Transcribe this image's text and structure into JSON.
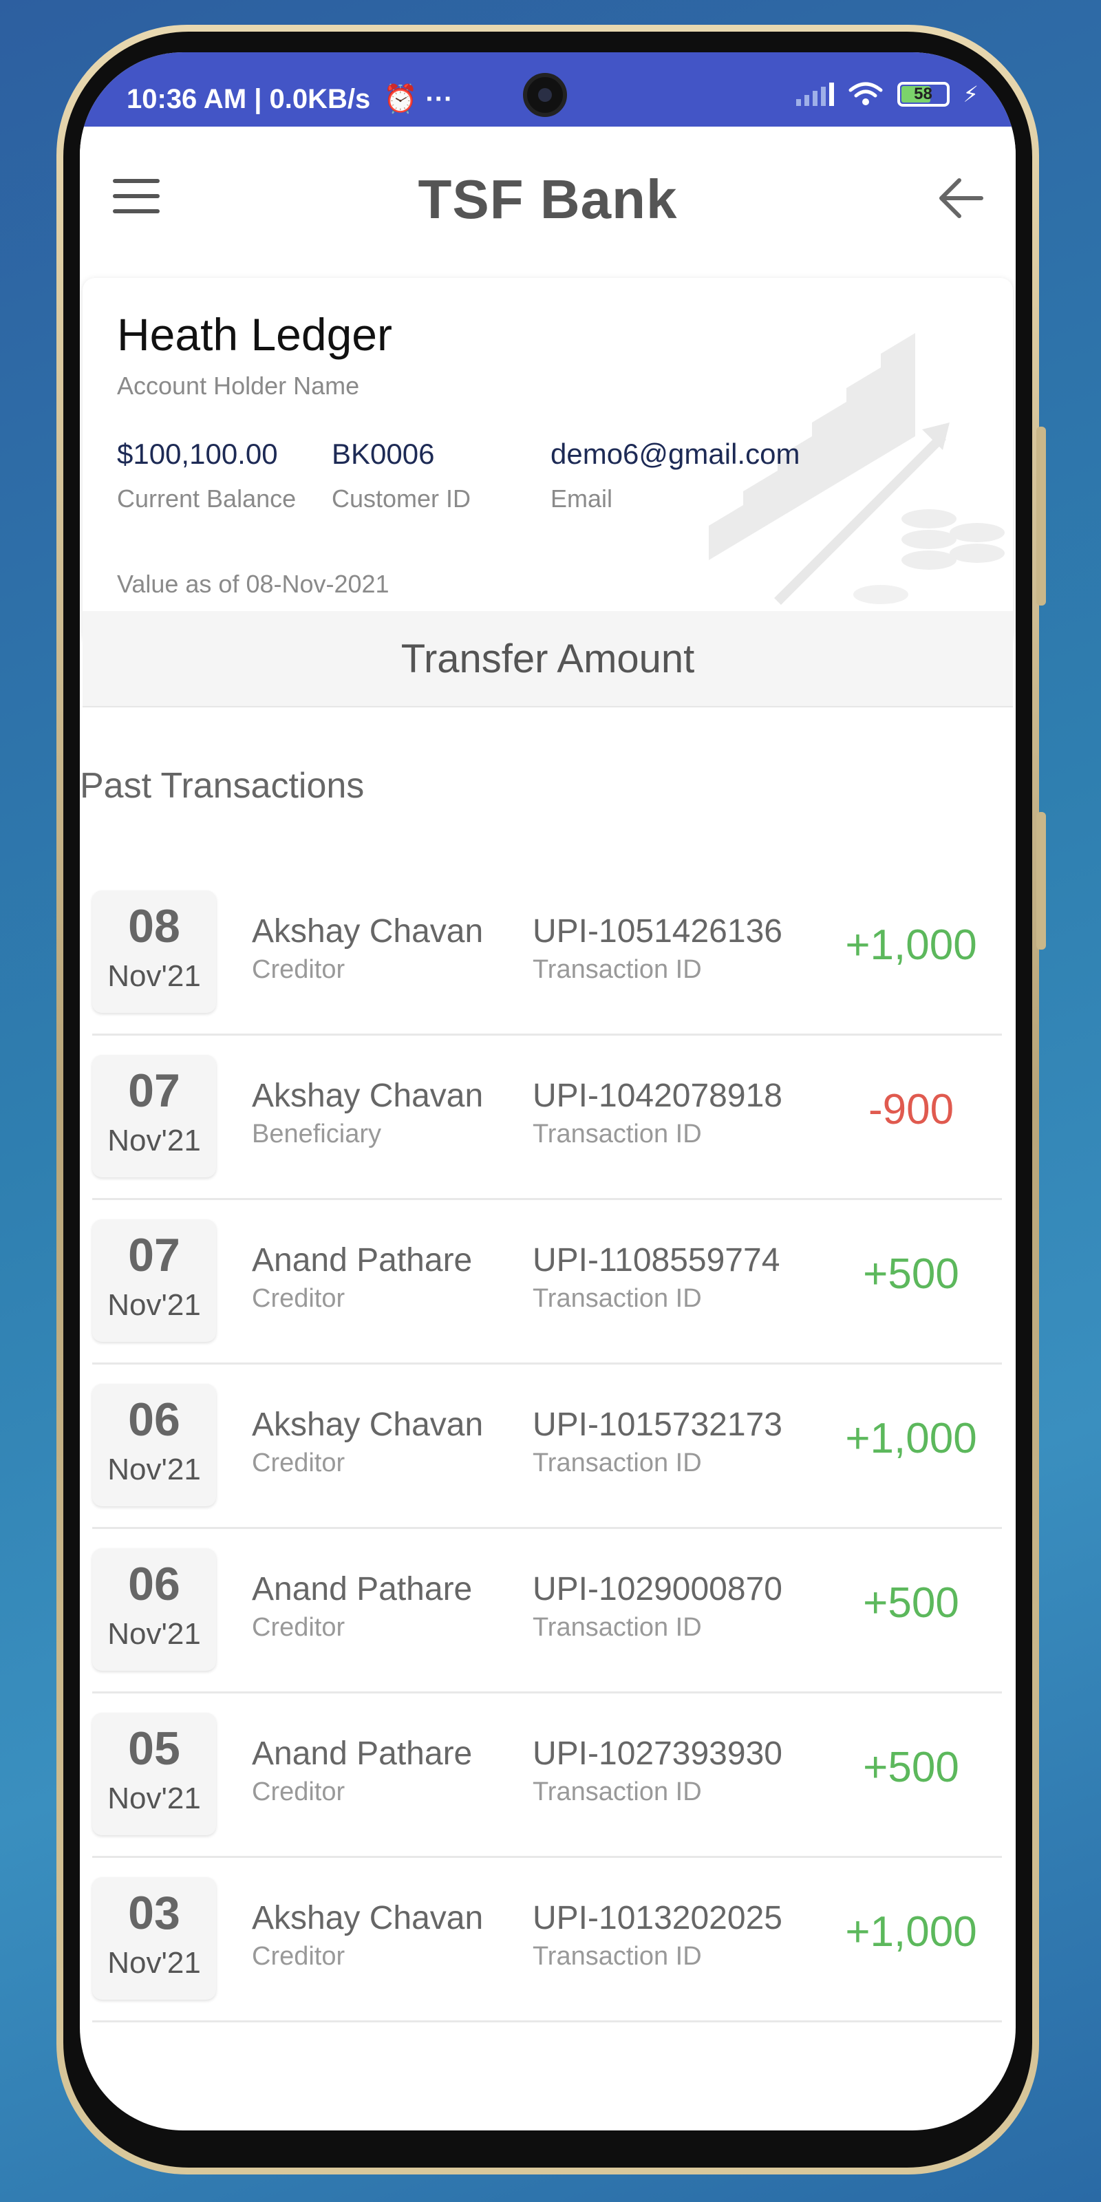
{
  "status_bar": {
    "time": "10:36 AM | 0.0KB/s",
    "extra": "⏰ ···",
    "battery": "58"
  },
  "header": {
    "title": "TSF Bank"
  },
  "account": {
    "holder_name": "Heath Ledger",
    "holder_label": "Account Holder Name",
    "balance": "$100,100.00",
    "balance_label": "Current Balance",
    "customer_id": "BK0006",
    "customer_id_label": "Customer ID",
    "email": "demo6@gmail.com",
    "email_label": "Email",
    "value_as_of": "Value as of 08-Nov-2021"
  },
  "transfer_button": "Transfer Amount",
  "past_transactions_title": "Past Transactions",
  "colors": {
    "credit": "#5cb85c",
    "debit": "#e05a4f",
    "status_bar": "#4355c6"
  },
  "transactions": [
    {
      "day": "08",
      "month": "Nov'21",
      "name": "Akshay Chavan",
      "role": "Creditor",
      "txn_id": "UPI-1051426136",
      "txn_label": "Transaction ID",
      "amount": "+1,000",
      "type": "credit"
    },
    {
      "day": "07",
      "month": "Nov'21",
      "name": "Akshay Chavan",
      "role": "Beneficiary",
      "txn_id": "UPI-1042078918",
      "txn_label": "Transaction ID",
      "amount": "-900",
      "type": "debit"
    },
    {
      "day": "07",
      "month": "Nov'21",
      "name": "Anand Pathare",
      "role": "Creditor",
      "txn_id": "UPI-1108559774",
      "txn_label": "Transaction ID",
      "amount": "+500",
      "type": "credit"
    },
    {
      "day": "06",
      "month": "Nov'21",
      "name": "Akshay Chavan",
      "role": "Creditor",
      "txn_id": "UPI-1015732173",
      "txn_label": "Transaction ID",
      "amount": "+1,000",
      "type": "credit"
    },
    {
      "day": "06",
      "month": "Nov'21",
      "name": "Anand Pathare",
      "role": "Creditor",
      "txn_id": "UPI-1029000870",
      "txn_label": "Transaction ID",
      "amount": "+500",
      "type": "credit"
    },
    {
      "day": "05",
      "month": "Nov'21",
      "name": "Anand Pathare",
      "role": "Creditor",
      "txn_id": "UPI-1027393930",
      "txn_label": "Transaction ID",
      "amount": "+500",
      "type": "credit"
    },
    {
      "day": "03",
      "month": "Nov'21",
      "name": "Akshay Chavan",
      "role": "Creditor",
      "txn_id": "UPI-1013202025",
      "txn_label": "Transaction ID",
      "amount": "+1,000",
      "type": "credit"
    }
  ]
}
